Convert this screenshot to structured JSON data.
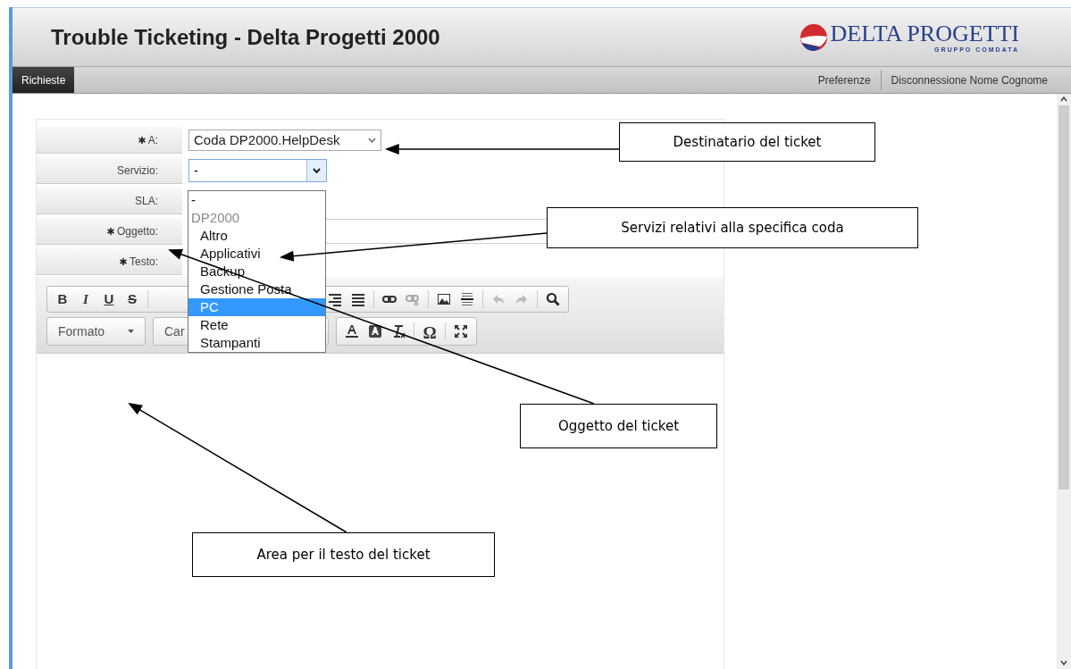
{
  "header": {
    "title": "Trouble Ticketing - Delta Progetti 2000",
    "logo_text": "DELTA PROGETTI",
    "logo_subtext": "GRUPPO COMDATA"
  },
  "nav": {
    "tabs": [
      {
        "label": "Richieste",
        "selected": true
      }
    ],
    "links": [
      "Preferenze",
      "Disconnessione Nome Cognome"
    ]
  },
  "form": {
    "fields": [
      {
        "label": "A:",
        "required": true,
        "kind": "select",
        "value": "Coda DP2000.HelpDesk"
      },
      {
        "label": "Servizio:",
        "required": false,
        "kind": "combo",
        "value": "-",
        "expanded": true
      },
      {
        "label": "SLA:",
        "required": false,
        "kind": "none"
      },
      {
        "label": "Oggetto:",
        "required": true,
        "kind": "input"
      },
      {
        "label": "Testo:",
        "required": true,
        "kind": "none"
      }
    ]
  },
  "service_options": [
    {
      "label": "-",
      "kind": "plain",
      "selected": false
    },
    {
      "label": "DP2000",
      "kind": "group",
      "selected": false
    },
    {
      "label": "Altro",
      "kind": "option",
      "selected": false
    },
    {
      "label": "Applicativi",
      "kind": "option",
      "selected": false
    },
    {
      "label": "Backup",
      "kind": "option",
      "selected": false
    },
    {
      "label": "Gestione Posta",
      "kind": "option",
      "selected": false
    },
    {
      "label": "PC",
      "kind": "option",
      "selected": true
    },
    {
      "label": "Rete",
      "kind": "option",
      "selected": false
    },
    {
      "label": "Stampanti",
      "kind": "option",
      "selected": false
    }
  ],
  "toolbar": {
    "bold": "B",
    "italic": "I",
    "underline": "U",
    "strike": "S",
    "format": "Formato",
    "font": "Car",
    "special_char": "Ω"
  },
  "callouts": [
    "Destinatario del ticket",
    "Servizi relativi alla specifica coda",
    "Oggetto del ticket",
    "Area per il testo del ticket"
  ]
}
